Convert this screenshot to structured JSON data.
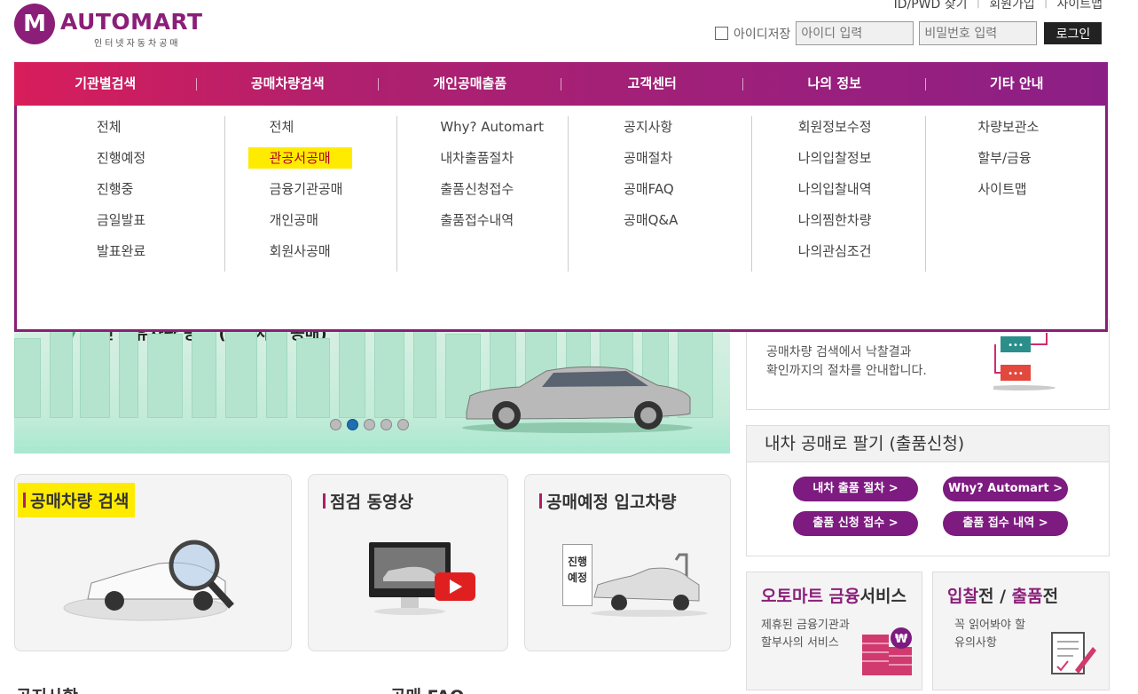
{
  "header": {
    "logo_letter": "M",
    "logo_name": "AUTOMART",
    "logo_sub": "인터넷자동차공매",
    "util_links": [
      "ID/PWD 찾기",
      "회원가입",
      "사이트맵"
    ],
    "remember_id_label": "아이디저장",
    "id_placeholder": "아이디 입력",
    "pw_placeholder": "비밀번호 입력",
    "login_label": "로그인"
  },
  "mega_menu": {
    "tabs": [
      "기관별검색",
      "공매차량검색",
      "개인공매출품",
      "고객센터",
      "나의 정보",
      "기타 안내"
    ],
    "columns": [
      [
        "전체",
        "진행예정",
        "진행중",
        "금일발표",
        "발표완료"
      ],
      [
        "전체",
        "관공서공매",
        "금융기관공매",
        "개인공매",
        "회원사공매"
      ],
      [
        "Why? Automart",
        "내차출품절차",
        "출품신청접수",
        "출품접수내역"
      ],
      [
        "공지사항",
        "공매절차",
        "공매FAQ",
        "공매Q&A"
      ],
      [
        "회원정보수정",
        "나의입찰정보",
        "나의입찰내역",
        "나의찜한차량",
        "나의관심조건"
      ],
      [
        "차량보관소",
        "할부/금융",
        "사이트맵"
      ]
    ],
    "highlighted": "관공서공매"
  },
  "banner": {
    "title": "개인 소유차량 공매 (개인차량 공매)",
    "slide_count": 5,
    "active_slide": 2
  },
  "right_panel": {
    "procedure_text_1": "공매차량 검색에서 낙찰결과",
    "procedure_text_2": "확인까지의 절차를 안내합니다.",
    "sell_title": "내차 공매로 팔기 (출품신청)",
    "sell_buttons": [
      "내차 출품 절차 >",
      "Why? Automart >",
      "출품 신청 접수 >",
      "출품 접수 내역 >"
    ],
    "finance_title_a": "오토마트 금융",
    "finance_title_b": "서비스",
    "finance_desc_1": "제휴된 금융기관과",
    "finance_desc_2": "할부사의 서비스",
    "notice_title_a": "입찰",
    "notice_title_b": "전 / ",
    "notice_title_c": "출품",
    "notice_title_d": "전",
    "notice_desc_1": "꼭 읽어봐야 할",
    "notice_desc_2": "유의사항"
  },
  "cards": {
    "search_title": "공매차량 검색",
    "video_title": "점검 동영상",
    "incoming_title": "공매예정 입고차량",
    "incoming_sign_1": "진행",
    "incoming_sign_2": "예정"
  },
  "bottom": {
    "notice_heading": "공지사항",
    "faq_heading": "공매 FAQ"
  },
  "colors": {
    "brand": "#8b1e78",
    "bar_start": "#d81d5a",
    "bar_end": "#8c1f86",
    "highlight": "#ffeb00"
  }
}
